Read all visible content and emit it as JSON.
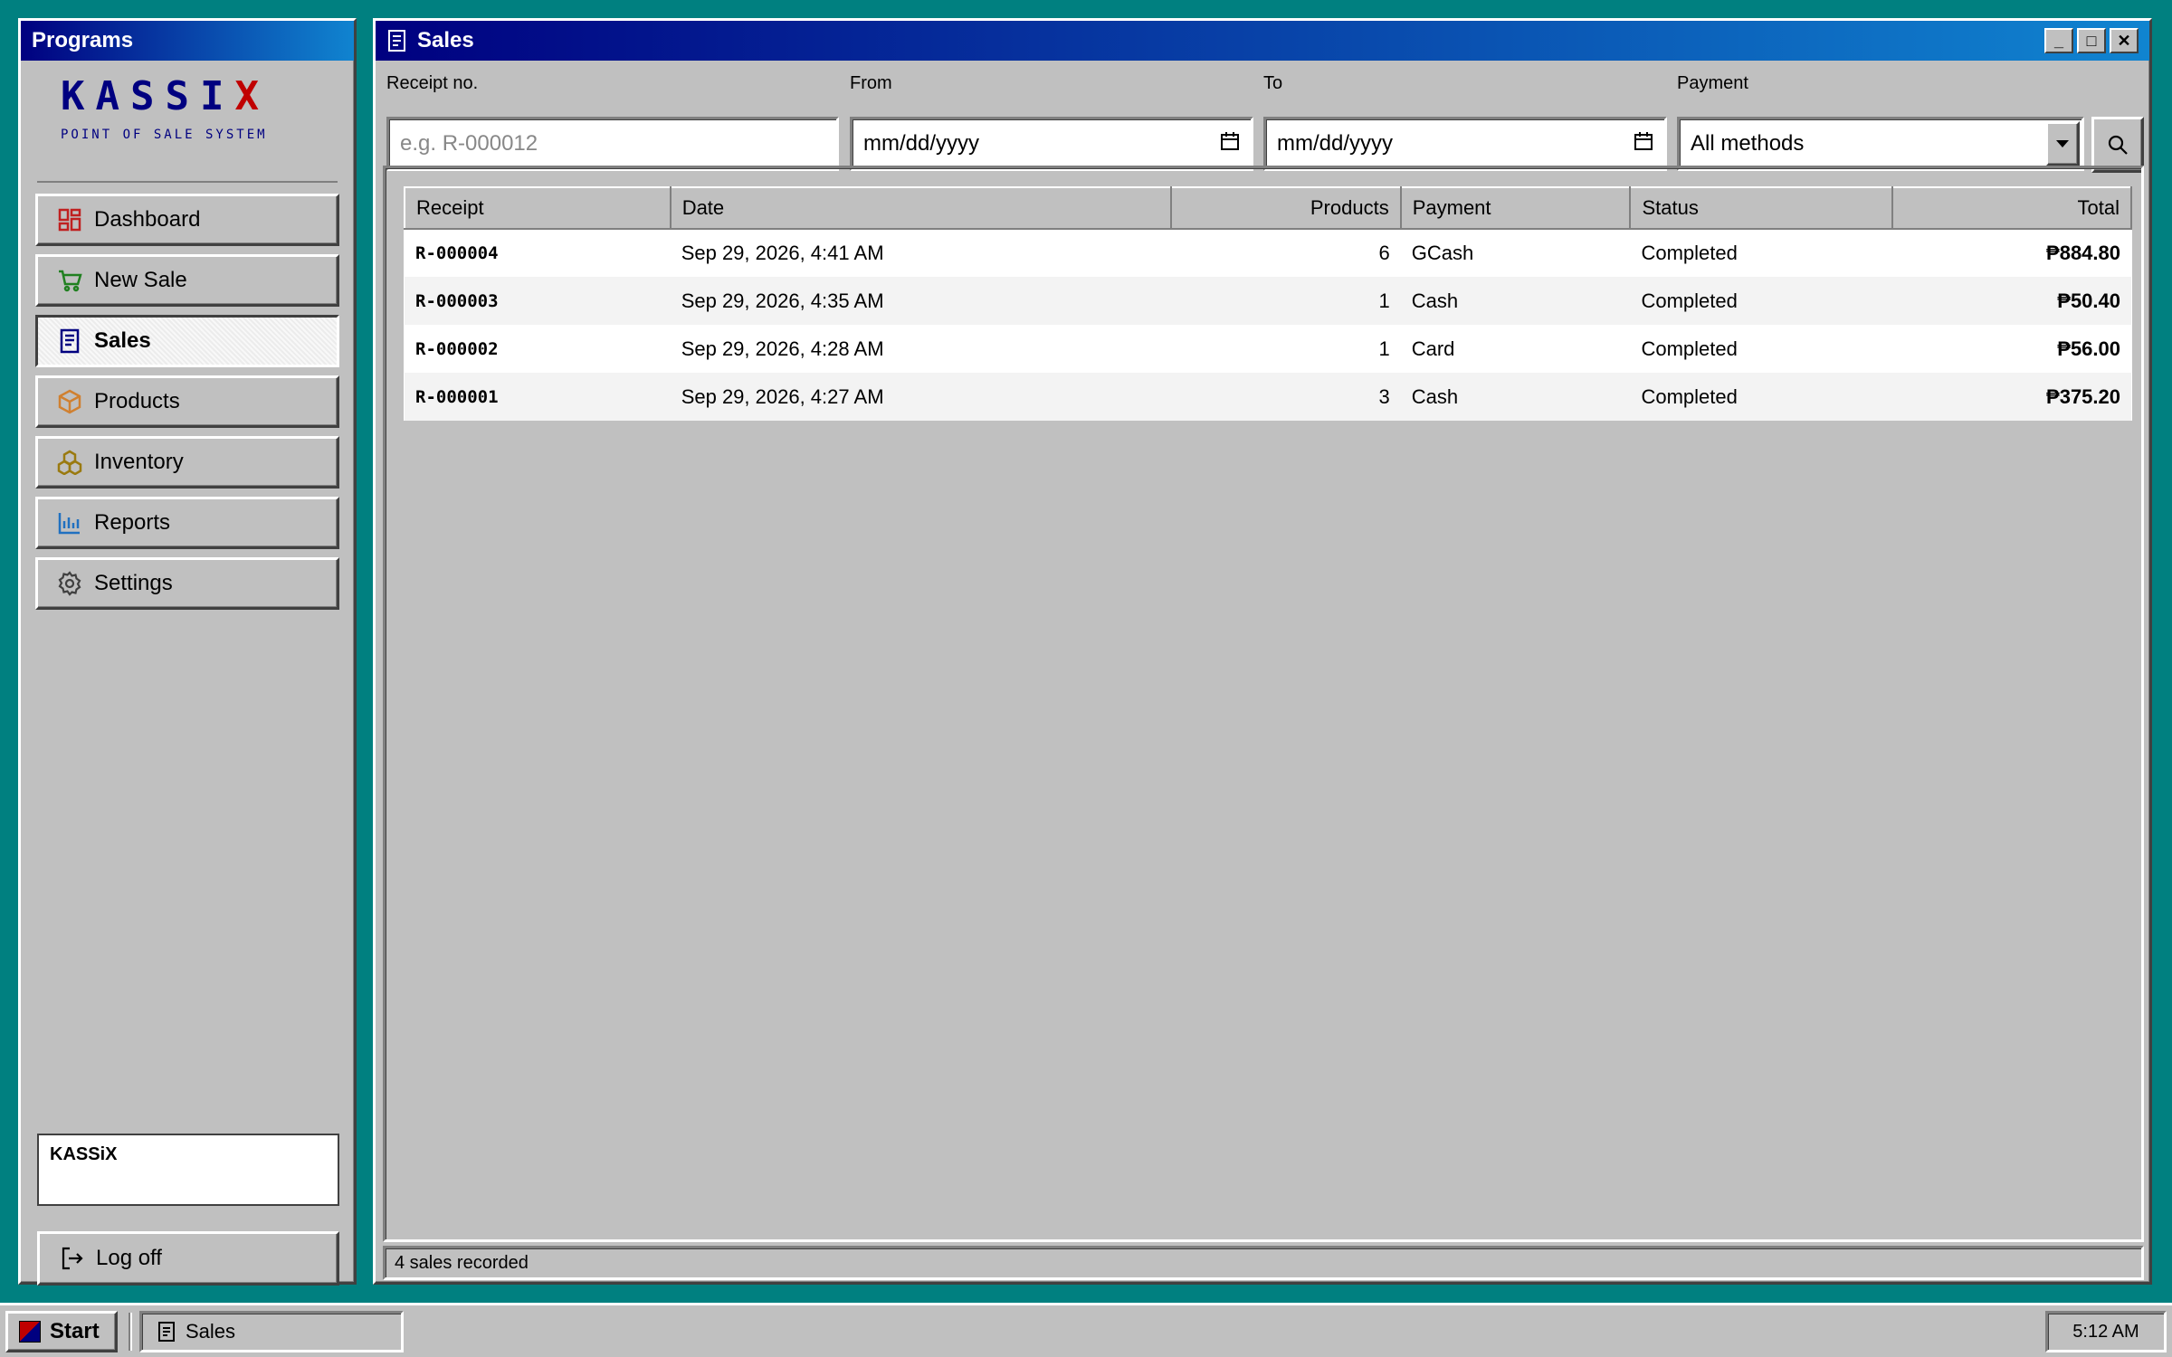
{
  "sidebar": {
    "title": "Programs",
    "logo": {
      "name_main": "KASSI",
      "name_x": "X",
      "subtitle": "POINT OF SALE SYSTEM"
    },
    "items": [
      {
        "label": "Dashboard",
        "icon": "dashboard-icon"
      },
      {
        "label": "New Sale",
        "icon": "cart-icon"
      },
      {
        "label": "Sales",
        "icon": "receipt-icon",
        "active": true
      },
      {
        "label": "Products",
        "icon": "box-icon"
      },
      {
        "label": "Inventory",
        "icon": "stack-icon"
      },
      {
        "label": "Reports",
        "icon": "bar-chart-icon"
      },
      {
        "label": "Settings",
        "icon": "gear-icon"
      }
    ],
    "user": "KASSiX",
    "logoff": "Log off"
  },
  "window": {
    "title": "Sales",
    "controls": {
      "minimize": "_",
      "maximize": "□",
      "close": "✕"
    }
  },
  "filters": {
    "receipt_label": "Receipt no.",
    "receipt_placeholder": "e.g. R-000012",
    "from_label": "From",
    "from_value": "mm/dd/yyyy",
    "to_label": "To",
    "to_value": "mm/dd/yyyy",
    "payment_label": "Payment",
    "payment_value": "All methods"
  },
  "table": {
    "columns": [
      "Receipt",
      "Date",
      "Products",
      "Payment",
      "Status",
      "Total"
    ],
    "rows": [
      {
        "receipt": "R-000004",
        "date": "Sep 29, 2026, 4:41 AM",
        "products": "6",
        "payment": "GCash",
        "status": "Completed",
        "total": "₱884.80"
      },
      {
        "receipt": "R-000003",
        "date": "Sep 29, 2026, 4:35 AM",
        "products": "1",
        "payment": "Cash",
        "status": "Completed",
        "total": "₱50.40"
      },
      {
        "receipt": "R-000002",
        "date": "Sep 29, 2026, 4:28 AM",
        "products": "1",
        "payment": "Card",
        "status": "Completed",
        "total": "₱56.00"
      },
      {
        "receipt": "R-000001",
        "date": "Sep 29, 2026, 4:27 AM",
        "products": "3",
        "payment": "Cash",
        "status": "Completed",
        "total": "₱375.20"
      }
    ]
  },
  "status_text": "4 sales recorded",
  "taskbar": {
    "start": "Start",
    "task": "Sales",
    "clock": "5:12 AM"
  },
  "colors": {
    "desktop": "#008080",
    "title_start": "#000080",
    "title_end": "#1084d0",
    "face": "#c0c0c0"
  }
}
